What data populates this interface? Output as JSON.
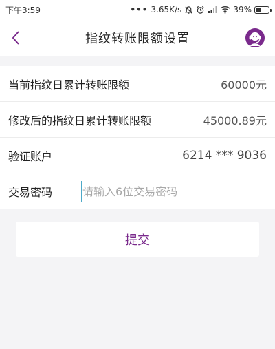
{
  "status_bar": {
    "time": "下午3:59",
    "dots": "•••",
    "network_speed": "3.65K/s",
    "battery_percent": "39%",
    "battery_level": 0.39
  },
  "nav": {
    "title": "指纹转账限额设置"
  },
  "form": {
    "current_limit_label": "当前指纹日累计转账限额",
    "current_limit_value": "60000元",
    "modified_limit_label": "修改后的指纹日累计转账限额",
    "modified_limit_value": "45000.89元",
    "account_label": "验证账户",
    "account_value": "6214 *** 9036",
    "password_label": "交易密码",
    "password_placeholder": "请输入6位交易密码"
  },
  "submit_label": "提交",
  "colors": {
    "accent": "#7a2a8c",
    "background": "#f4f4f6",
    "cursor": "#4da9c8"
  }
}
